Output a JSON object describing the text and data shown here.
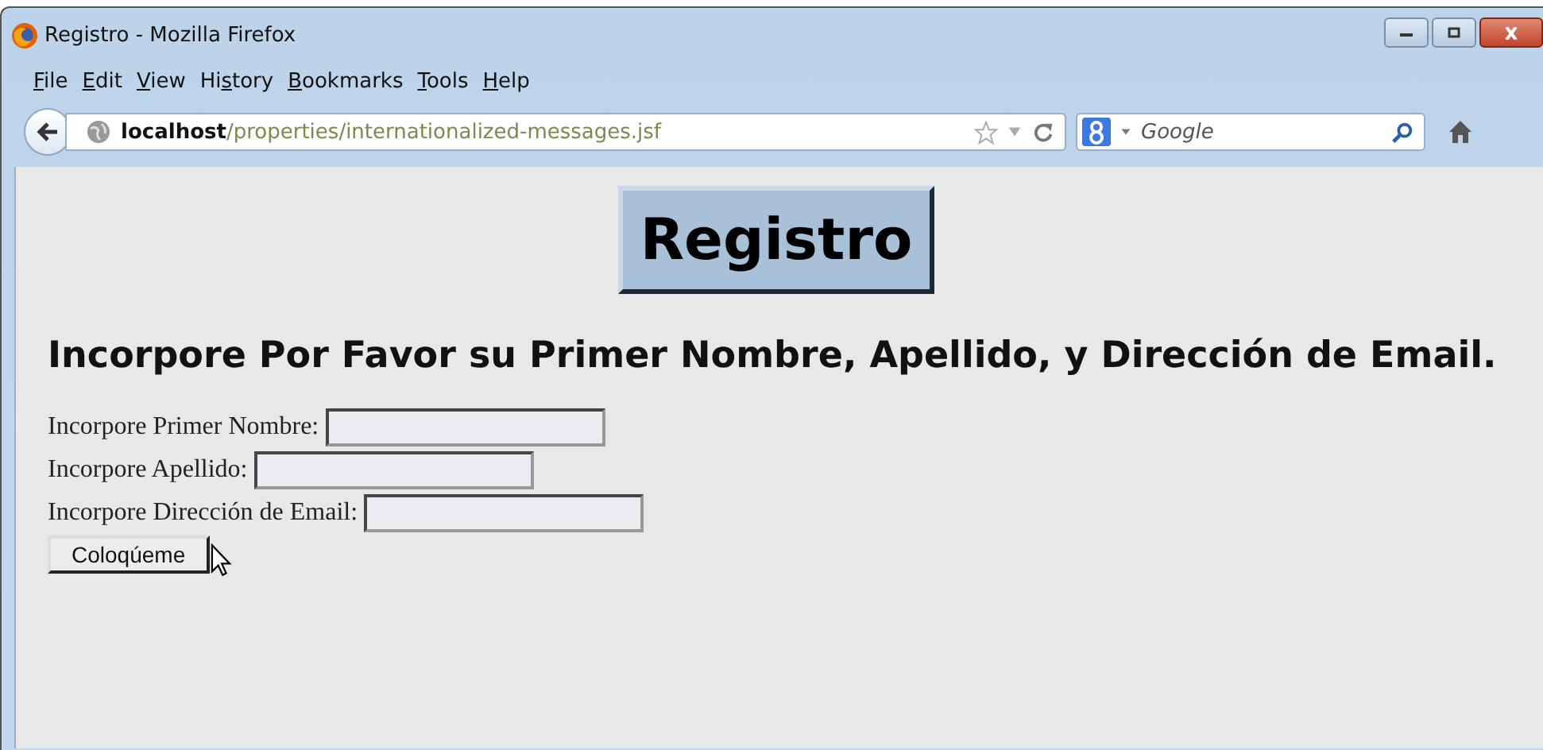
{
  "window": {
    "title": "Registro - Mozilla Firefox"
  },
  "menu": [
    {
      "key": "F",
      "post": "ile"
    },
    {
      "key": "E",
      "post": "dit"
    },
    {
      "key": "V",
      "post": "iew"
    },
    {
      "pre": "Hi",
      "key": "s",
      "post": "tory"
    },
    {
      "key": "B",
      "post": "ookmarks"
    },
    {
      "key": "T",
      "post": "ools"
    },
    {
      "key": "H",
      "post": "elp"
    }
  ],
  "address": {
    "host": "localhost",
    "path": "/properties/internationalized-messages.jsf"
  },
  "search": {
    "placeholder": "Google"
  },
  "page": {
    "heading": "Registro",
    "subheading": "Incorpore Por Favor su Primer Nombre, Apellido, y Dirección de Email.",
    "fields": [
      {
        "label": "Incorpore Primer Nombre:"
      },
      {
        "label": "Incorpore Apellido:"
      },
      {
        "label": "Incorpore Dirección de Email:"
      }
    ],
    "button": "Coloqúeme"
  }
}
